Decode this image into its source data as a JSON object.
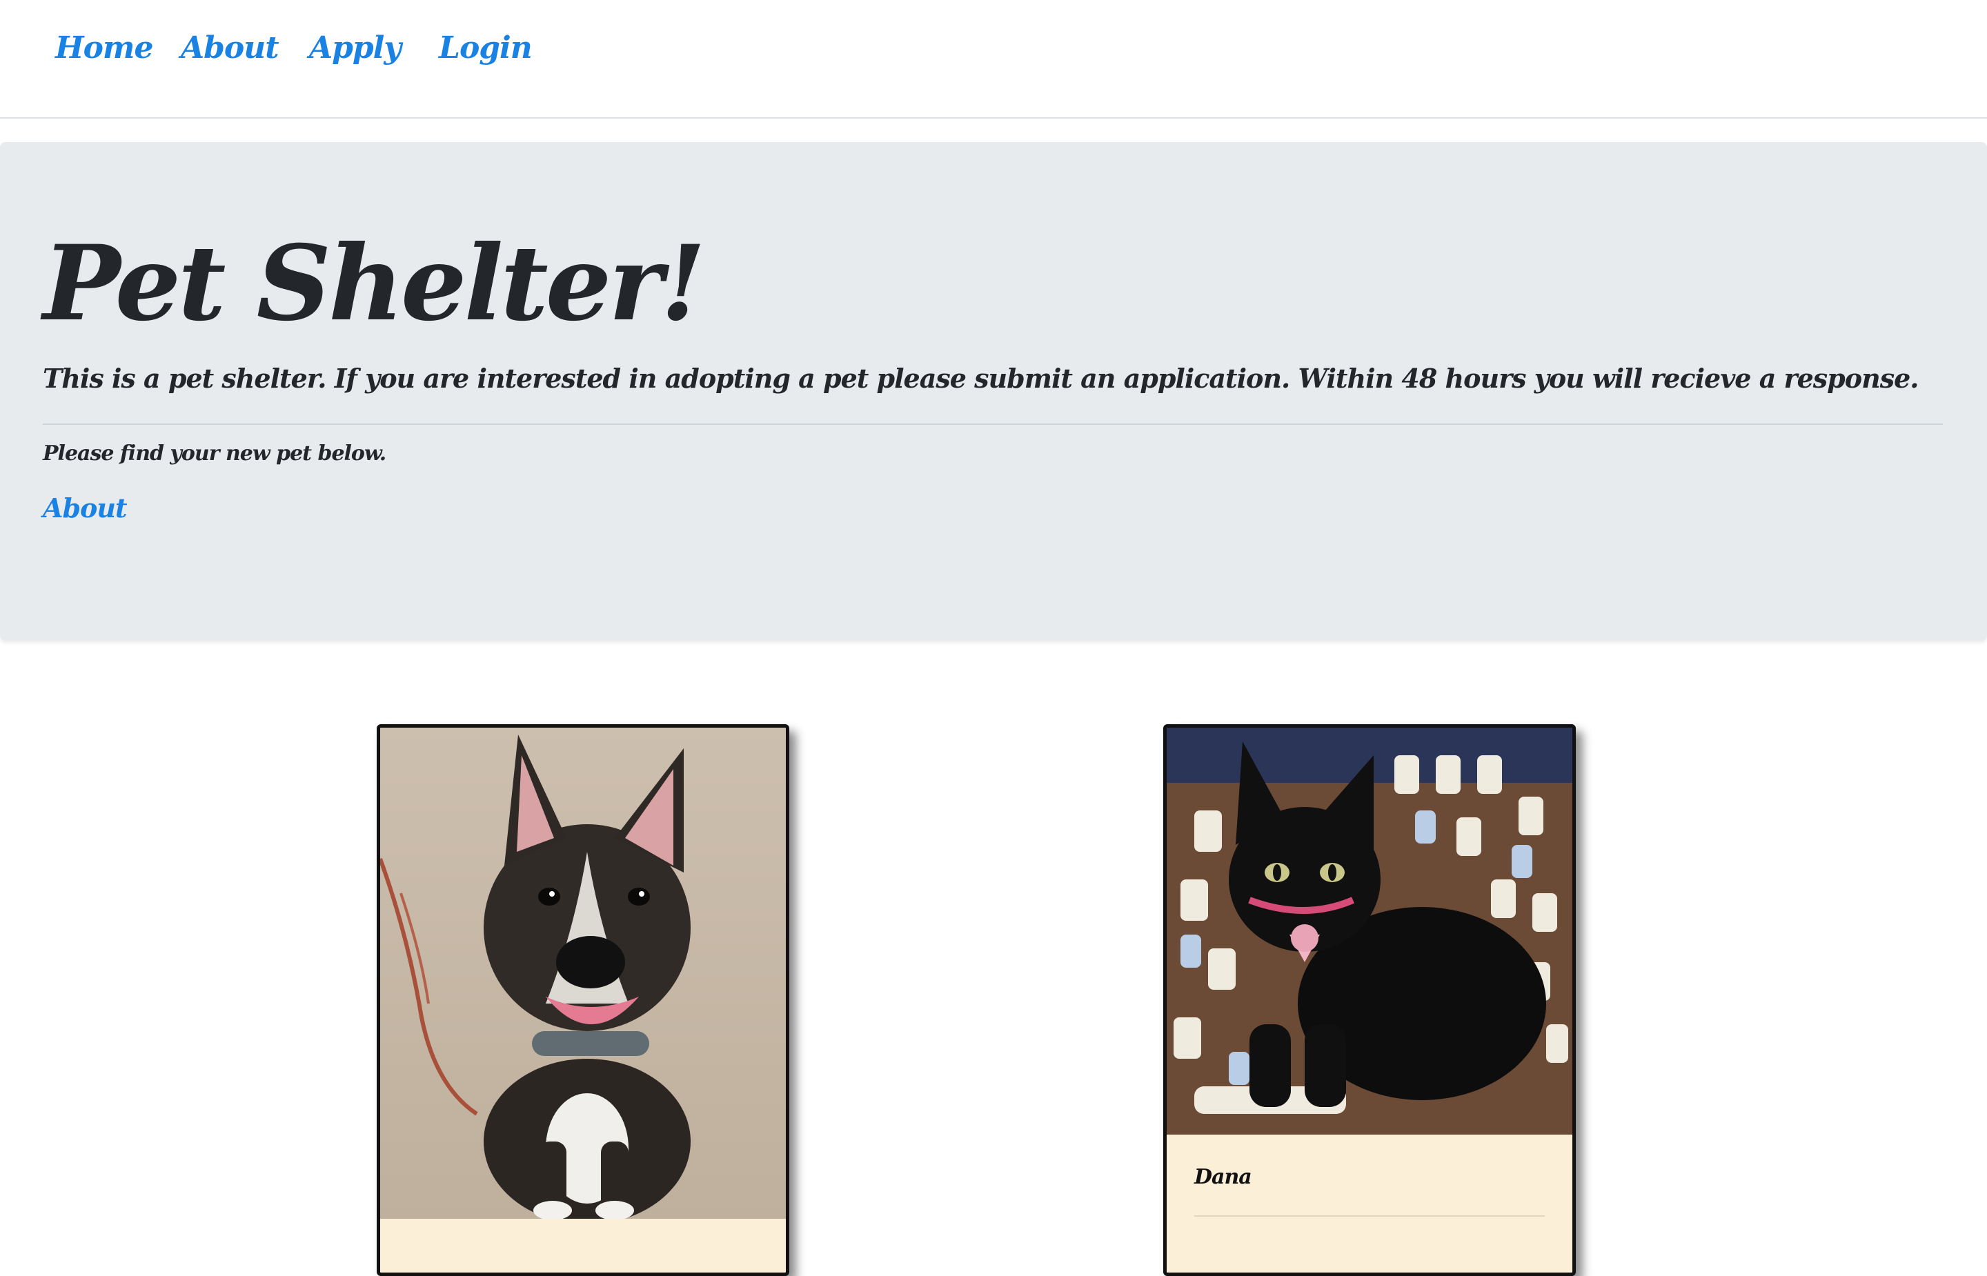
{
  "nav": {
    "home": "Home",
    "about": "About",
    "apply": "Apply",
    "login": "Login"
  },
  "hero": {
    "title": "Pet Shelter!",
    "lead": "This is a pet shelter. If you are interested in adopting a pet please submit an application. Within 48 hours you will recieve a response.",
    "sub": "Please find your new pet below.",
    "link": "About"
  },
  "pets": [
    {
      "name": "",
      "image_alt": "dog-photo"
    },
    {
      "name": "Dana",
      "image_alt": "cat-photo"
    }
  ],
  "colors": {
    "link": "#1a82e2",
    "jumbotron_bg": "#e8ebee",
    "card_bg": "#fcefd8",
    "card_border": "#111111"
  }
}
